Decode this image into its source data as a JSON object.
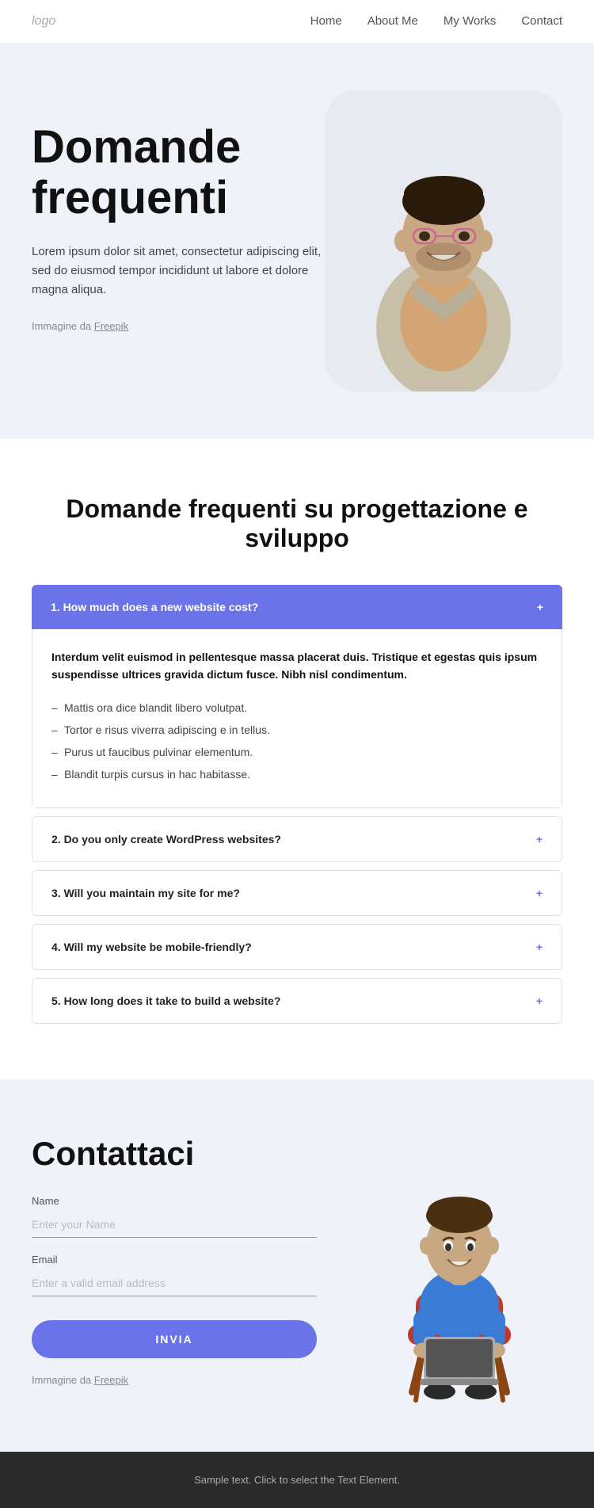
{
  "nav": {
    "logo": "logo",
    "links": [
      {
        "label": "Home",
        "href": "#"
      },
      {
        "label": "About Me",
        "href": "#"
      },
      {
        "label": "My Works",
        "href": "#"
      },
      {
        "label": "Contact",
        "href": "#"
      }
    ]
  },
  "hero": {
    "title_line1": "Domande",
    "title_line2": "frequenti",
    "description": "Lorem ipsum dolor sit amet, consectetur adipiscing elit, sed do eiusmod tempor incididunt ut labore et dolore magna aliqua.",
    "image_credit_prefix": "Immagine da ",
    "image_credit_link": "Freepik"
  },
  "faq": {
    "section_title": "Domande frequenti su progettazione e sviluppo",
    "items": [
      {
        "id": 1,
        "question": "1. How much does a new website cost?",
        "open": true,
        "answer_bold": "Interdum velit euismod in pellentesque massa placerat duis. Tristique et egestas quis ipsum suspendisse ultrices gravida dictum fusce. Nibh nisl condimentum.",
        "answer_list": [
          "Mattis ora dice blandit libero volutpat.",
          "Tortor e risus viverra adipiscing e in tellus.",
          "Purus ut faucibus pulvinar elementum.",
          "Blandit turpis cursus in hac habitasse."
        ]
      },
      {
        "id": 2,
        "question": "2. Do you only create WordPress websites?",
        "open": false
      },
      {
        "id": 3,
        "question": "3. Will you maintain my site for me?",
        "open": false
      },
      {
        "id": 4,
        "question": "4. Will my website be mobile-friendly?",
        "open": false
      },
      {
        "id": 5,
        "question": "5. How long does it take to build a website?",
        "open": false
      }
    ]
  },
  "contact": {
    "title": "Contattaci",
    "name_label": "Name",
    "name_placeholder": "Enter your Name",
    "email_label": "Email",
    "email_placeholder": "Enter a valid email address",
    "submit_label": "INVIA",
    "image_credit_prefix": "Immagine da ",
    "image_credit_link": "Freepik"
  },
  "footer": {
    "text": "Sample text. Click to select the Text Element."
  }
}
